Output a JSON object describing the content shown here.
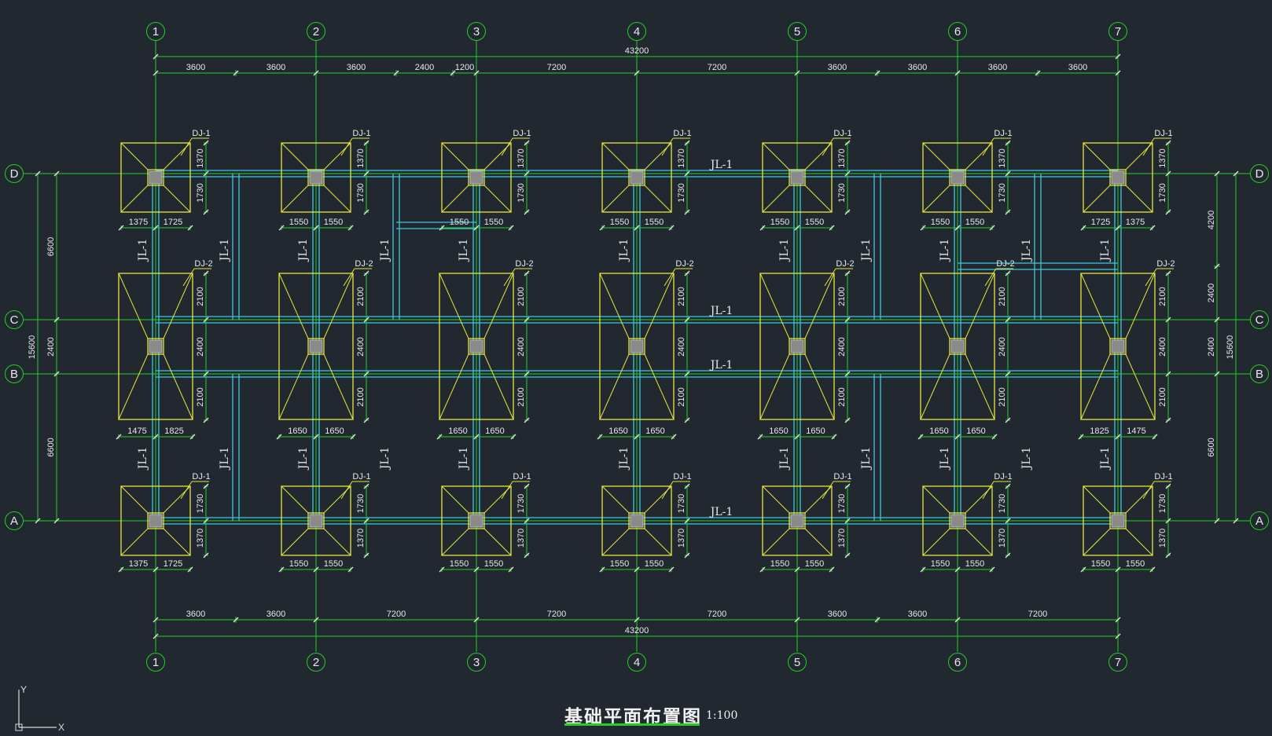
{
  "drawing": {
    "title": "基础平面布置图",
    "scale": "1:100",
    "axes": {
      "columns": [
        "1",
        "2",
        "3",
        "4",
        "5",
        "6",
        "7"
      ],
      "rows": [
        "D",
        "C",
        "B",
        "A"
      ]
    },
    "dims_top_overall": "43200",
    "dims_top": [
      "3600",
      "3600",
      "3600",
      "2400",
      "1200",
      "7200",
      "7200",
      "3600",
      "3600",
      "3600",
      "3600"
    ],
    "dims_bottom": [
      "3600",
      "3600",
      "7200",
      "7200",
      "7200",
      "3600",
      "3600",
      "7200"
    ],
    "dims_bottom_overall": "43200",
    "dims_left_overall": "15600",
    "dims_left": [
      "6600",
      "2400",
      "6600"
    ],
    "dims_right_overall": "15600",
    "dims_right": [
      "4200",
      "2400",
      "2400",
      "6600"
    ],
    "beam_label": "JL-1",
    "footing_labels": {
      "type1": "DJ-1",
      "type2": "DJ-2"
    },
    "footing_dims": {
      "d_row_left": [
        "1375",
        "1725"
      ],
      "d_row_mid": [
        "1550",
        "1550"
      ],
      "d_row_right": [
        "1725",
        "1375"
      ],
      "d_row_vert": [
        "1370",
        "1730"
      ],
      "c_row_vert": [
        "2100",
        "2400"
      ],
      "b_row_vert": [
        "2100"
      ],
      "b_row_left": [
        "1475",
        "1825"
      ],
      "b_row_mid": [
        "1650",
        "1650"
      ],
      "b_row_right": [
        "1825",
        "1475"
      ],
      "a_row_vert": [
        "1730",
        "1370"
      ],
      "a_row_left": [
        "1375",
        "1725"
      ],
      "a_row_mid": [
        "1550",
        "1550"
      ]
    },
    "colors": {
      "background": "#212830",
      "axis": "#22d022",
      "footing": "#e6e63c",
      "beam": "#3cc8dc",
      "text": "#e8e8e8",
      "column": "#8a8a8a"
    },
    "ucs": {
      "x": "X",
      "y": "Y"
    }
  }
}
